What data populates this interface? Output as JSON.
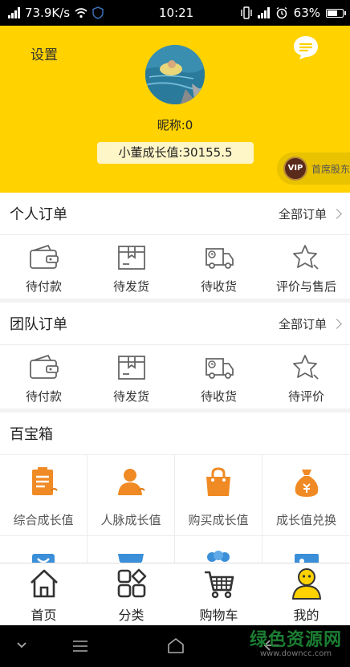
{
  "status_bar": {
    "speed": "73.9K/s",
    "time": "10:21",
    "battery": "63%"
  },
  "header": {
    "settings_label": "设置",
    "nickname": "昵称:0",
    "growth_value": "小董成长值:30155.5",
    "vip_badge": "VIP",
    "vip_label": "首席股东"
  },
  "personal_orders": {
    "title": "个人订单",
    "all_label": "全部订单",
    "items": [
      {
        "label": "待付款",
        "icon": "wallet-icon"
      },
      {
        "label": "待发货",
        "icon": "box-icon"
      },
      {
        "label": "待收货",
        "icon": "truck-icon"
      },
      {
        "label": "评价与售后",
        "icon": "star-icon"
      }
    ]
  },
  "team_orders": {
    "title": "团队订单",
    "all_label": "全部订单",
    "items": [
      {
        "label": "待付款",
        "icon": "wallet-icon"
      },
      {
        "label": "待发货",
        "icon": "box-icon"
      },
      {
        "label": "待收货",
        "icon": "truck-icon"
      },
      {
        "label": "待评价",
        "icon": "star-icon"
      }
    ]
  },
  "toolbox": {
    "title": "百宝箱",
    "items": [
      {
        "label": "综合成长值",
        "icon": "clipboard-icon"
      },
      {
        "label": "人脉成长值",
        "icon": "person-icon"
      },
      {
        "label": "购买成长值",
        "icon": "shopping-bag-icon"
      },
      {
        "label": "成长值兑换",
        "icon": "money-bag-icon"
      }
    ]
  },
  "tab_bar": {
    "items": [
      {
        "label": "首页",
        "icon": "home-icon"
      },
      {
        "label": "分类",
        "icon": "category-icon"
      },
      {
        "label": "购物车",
        "icon": "cart-icon"
      },
      {
        "label": "我的",
        "icon": "user-icon"
      }
    ]
  },
  "watermark": {
    "title": "绿色资源网",
    "url": "www.downcc.com"
  },
  "colors": {
    "brand_yellow": "#ffd200",
    "accent_orange": "#f08a24",
    "blue_icon": "#3b8fd8"
  }
}
